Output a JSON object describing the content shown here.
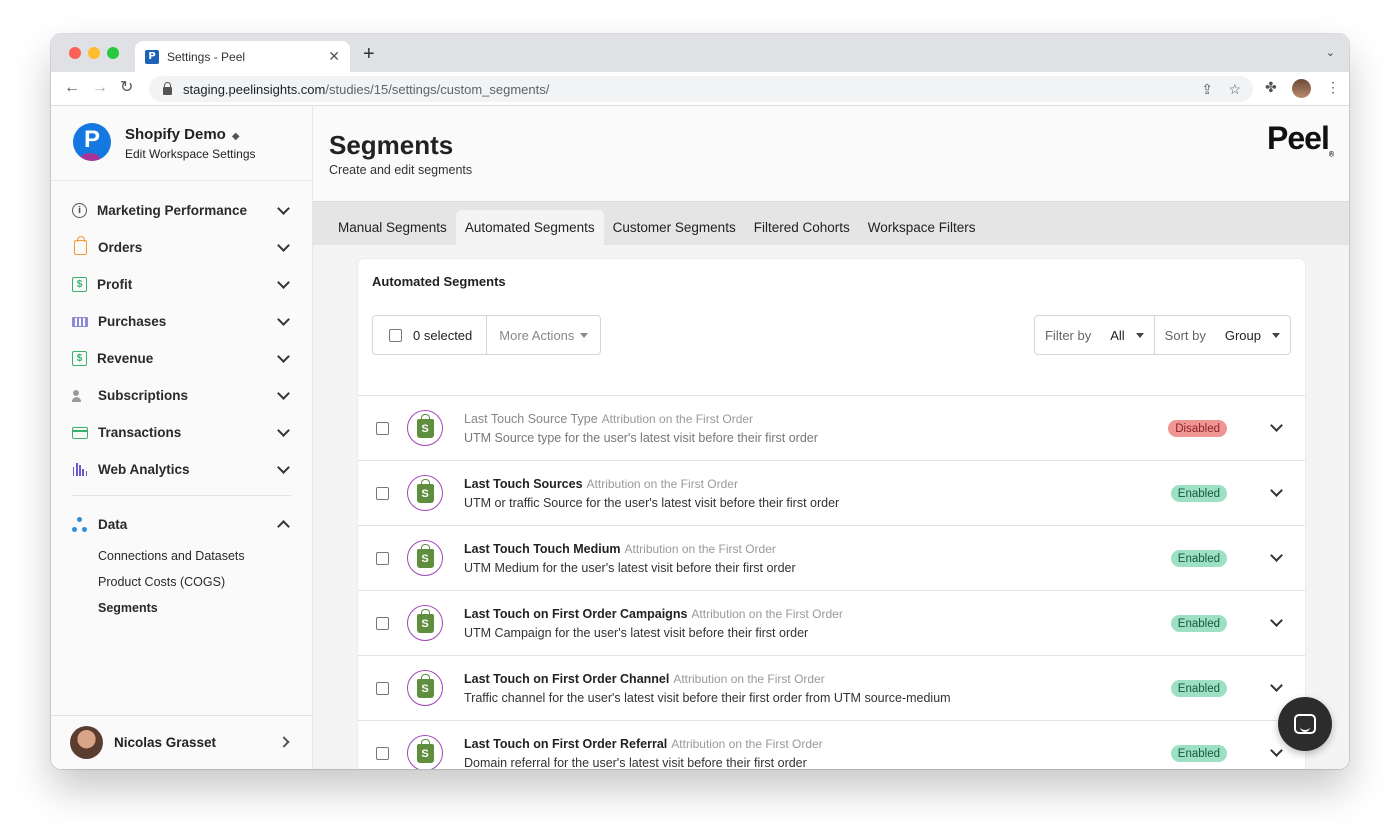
{
  "browser": {
    "tab_title": "Settings - Peel",
    "favicon_letter": "P",
    "url_host": "staging.peelinsights.com",
    "url_path": "/studies/15/settings/custom_segments/"
  },
  "sidebar": {
    "workspace_logo_letter": "P",
    "workspace_name": "Shopify Demo",
    "workspace_subtitle": "Edit Workspace Settings",
    "nav": [
      {
        "label": "Marketing Performance",
        "icon": "info-icon"
      },
      {
        "label": "Orders",
        "icon": "shopping-bag-icon"
      },
      {
        "label": "Profit",
        "icon": "dollar-icon"
      },
      {
        "label": "Purchases",
        "icon": "purchases-icon"
      },
      {
        "label": "Revenue",
        "icon": "dollar-icon"
      },
      {
        "label": "Subscriptions",
        "icon": "user-check-icon"
      },
      {
        "label": "Transactions",
        "icon": "credit-card-icon"
      },
      {
        "label": "Web Analytics",
        "icon": "bar-chart-icon"
      }
    ],
    "data_section": {
      "label": "Data",
      "icon": "data-network-icon",
      "items": [
        "Connections and Datasets",
        "Product Costs (COGS)",
        "Segments"
      ]
    },
    "user_name": "Nicolas Grasset"
  },
  "main": {
    "title": "Segments",
    "subtitle": "Create and edit segments",
    "brand": "Peel",
    "tabs": [
      "Manual Segments",
      "Automated Segments",
      "Customer Segments",
      "Filtered Cohorts",
      "Workspace Filters"
    ],
    "active_tab": "Automated Segments",
    "card_title": "Automated Segments",
    "selected_count": "0 selected",
    "more_actions": "More Actions",
    "filter_label": "Filter by",
    "filter_value": "All",
    "sort_label": "Sort by",
    "sort_value": "Group"
  },
  "segments": [
    {
      "name": "Last Touch Source Type",
      "category": "Attribution on the First Order",
      "description": "UTM Source type for the user's latest visit before their first order",
      "status": "Disabled"
    },
    {
      "name": "Last Touch Sources",
      "category": "Attribution on the First Order",
      "description": "UTM or traffic Source for the user's latest visit before their first order",
      "status": "Enabled"
    },
    {
      "name": "Last Touch Touch Medium",
      "category": "Attribution on the First Order",
      "description": "UTM Medium for the user's latest visit before their first order",
      "status": "Enabled"
    },
    {
      "name": "Last Touch on First Order Campaigns",
      "category": "Attribution on the First Order",
      "description": "UTM Campaign for the user's latest visit before their first order",
      "status": "Enabled"
    },
    {
      "name": "Last Touch on First Order Channel",
      "category": "Attribution on the First Order",
      "description": "Traffic channel for the user's latest visit before their first order from UTM source-medium",
      "status": "Enabled"
    },
    {
      "name": "Last Touch on First Order Referral",
      "category": "Attribution on the First Order",
      "description": "Domain referral for the user's latest visit before their first order",
      "status": "Enabled"
    }
  ],
  "colors": {
    "enabled_badge": "#9de0c4",
    "disabled_badge": "#f19494",
    "shopify_green": "#5e8e3e",
    "accent_blue": "#1478e0"
  }
}
